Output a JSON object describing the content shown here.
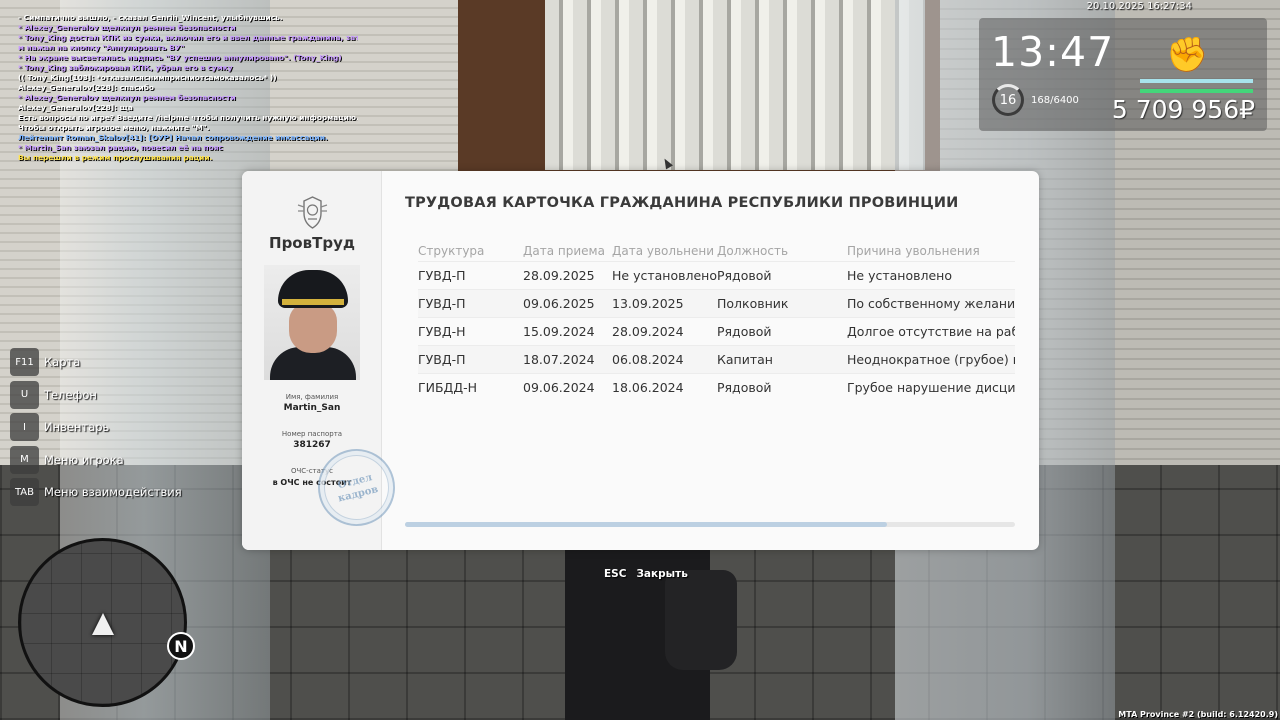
{
  "chat": [
    {
      "text": "- Симпатично вышло, - сказал Genrih_Wincent, улыбнувшись.",
      "color": "#ffffff"
    },
    {
      "text": "* Alexey_Generalov щелкнул ремнем безопасности",
      "color": "#c79bff"
    },
    {
      "text": "* Tony_King достал КПК из сумки, включил его и ввел данные гражданина, зате",
      "color": "#c79bff"
    },
    {
      "text": "м нажал на кнопку \"Аннулировать ВУ\"",
      "color": "#c79bff"
    },
    {
      "text": "* На экране высветилась надпись \"ВУ успешно аннулировано\". (Tony_King)",
      "color": "#c79bff"
    },
    {
      "text": "* Tony_King заблокировал КПК, убрал его в сумку",
      "color": "#c79bff"
    },
    {
      "text": "(( Tony_King[103]: *отказалсяснимприсниотсамоказалось* ))",
      "color": "#ffffff"
    },
    {
      "text": "Alexey_Generalov[228]: спасибо",
      "color": "#ffffff"
    },
    {
      "text": "* Alexey_Generalov щелкнул ремнем безопасности",
      "color": "#c79bff"
    },
    {
      "text": "Alexey_Generalov[228]: ща",
      "color": "#ffffff"
    },
    {
      "text": "Есть вопросы по игре? Введите /helpme чтобы получить нужную информацию.",
      "color": "#ffffff"
    },
    {
      "text": "Чтобы открыть игровое меню, нажмите \"М\".",
      "color": "#ffffff"
    },
    {
      "text": "Лейтенант Roman_Skalov[41]: [ОУР] Начал сопровождение инкассации.",
      "color": "#7fb6ff"
    },
    {
      "text": "* Martin_San заюзал рацию, повесил её на пояс",
      "color": "#c79bff"
    },
    {
      "text": "Вы перешли в режим прослушивания рации.",
      "color": "#ffe34d"
    }
  ],
  "hud": {
    "datetime": "20.10.2025 16:27:34",
    "clock": "13:47",
    "level": "16",
    "xp": "168/6400",
    "money": "5 709 956₽",
    "health_level": 1.0,
    "armor_level": 1.0
  },
  "keys": [
    {
      "key": "F11",
      "label": "Карта"
    },
    {
      "key": "U",
      "label": "Телефон"
    },
    {
      "key": "I",
      "label": "Инвентарь"
    },
    {
      "key": "M",
      "label": "Меню игрока"
    },
    {
      "key": "TAB",
      "label": "Меню взаимодействия"
    }
  ],
  "minimap": {
    "north": "N"
  },
  "card": {
    "org": "ПровТруд",
    "name_label": "Имя, фамилия",
    "name": "Martin_San",
    "passport_label": "Номер паспорта",
    "passport": "381267",
    "status_label": "ОЧС-статус",
    "status": "в ОЧС не состоит",
    "stamp_line1": "Отдел",
    "stamp_line2": "кадров",
    "title": "ТРУДОВАЯ КАРТОЧКА ГРАЖДАНИНА РЕСПУБЛИКИ ПРОВИНЦИИ",
    "columns": [
      "Структура",
      "Дата приема",
      "Дата увольнени",
      "Должность",
      "Причина увольнения"
    ],
    "rows": [
      [
        "ГУВД-П",
        "28.09.2025",
        "Не установлено",
        "Рядовой",
        "Не установлено"
      ],
      [
        "ГУВД-П",
        "09.06.2025",
        "13.09.2025",
        "Полковник",
        "По собственному желанию."
      ],
      [
        "ГУВД-Н",
        "15.09.2024",
        "28.09.2024",
        "Рядовой",
        "Долгое отсутствие на рабоче"
      ],
      [
        "ГУВД-П",
        "18.07.2024",
        "06.08.2024",
        "Капитан",
        "Неоднократное (грубое) нар"
      ],
      [
        "ГИБДД-Н",
        "09.06.2024",
        "18.06.2024",
        "Рядовой",
        "Грубое нарушение дисципли"
      ]
    ],
    "scroll_position": 0.79
  },
  "close_hint": {
    "key": "ESC",
    "label": "Закрыть"
  },
  "build": "MTA Province #2 (build: 6.12420.9)"
}
